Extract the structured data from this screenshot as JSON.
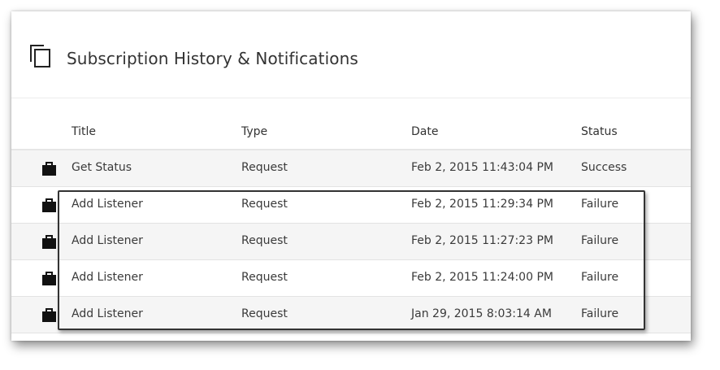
{
  "panel": {
    "title": "Subscription History & Notifications",
    "title_icon": "copy-icon"
  },
  "table": {
    "columns": [
      "Title",
      "Type",
      "Date",
      "Status"
    ],
    "row_icon": "briefcase-icon",
    "rows": [
      {
        "title": "Get Status",
        "type": "Request",
        "date": "Feb 2, 2015 11:43:04 PM",
        "status": "Success"
      },
      {
        "title": "Add Listener",
        "type": "Request",
        "date": "Feb 2, 2015 11:29:34 PM",
        "status": "Failure"
      },
      {
        "title": "Add Listener",
        "type": "Request",
        "date": "Feb 2, 2015 11:27:23 PM",
        "status": "Failure"
      },
      {
        "title": "Add Listener",
        "type": "Request",
        "date": "Feb 2, 2015 11:24:00 PM",
        "status": "Failure"
      },
      {
        "title": "Add Listener",
        "type": "Request",
        "date": "Jan 29, 2015 8:03:14 AM",
        "status": "Failure"
      }
    ]
  },
  "colors": {
    "text": "#333333",
    "row_alt": "#f5f5f5",
    "highlight_border": "#333333"
  }
}
